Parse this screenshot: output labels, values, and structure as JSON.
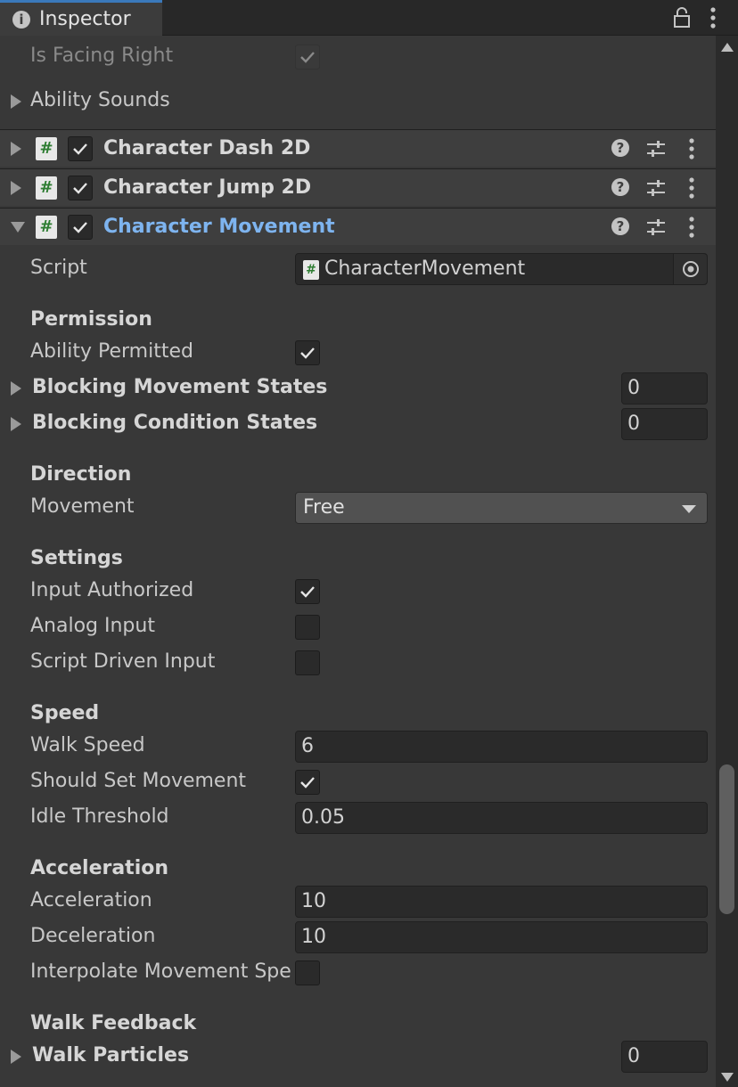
{
  "window": {
    "tab_title": "Inspector",
    "tab_icon": "info-icon",
    "lock_icon": "lock-icon",
    "menu_icon": "kebab-menu-icon"
  },
  "previous_component": {
    "is_facing_right_label": "Is Facing Right",
    "is_facing_right_checked": true,
    "ability_sounds_label": "Ability Sounds"
  },
  "components": [
    {
      "name": "Character Dash 2D",
      "expanded": false,
      "enabled": true
    },
    {
      "name": "Character Jump 2D",
      "expanded": false,
      "enabled": true
    },
    {
      "name": "Character Movement",
      "expanded": true,
      "enabled": true
    }
  ],
  "movement": {
    "script_label": "Script",
    "script_value": "CharacterMovement",
    "permission": {
      "header": "Permission",
      "ability_permitted_label": "Ability Permitted",
      "ability_permitted": true,
      "blocking_movement_states_label": "Blocking Movement States",
      "blocking_movement_states_count": "0",
      "blocking_condition_states_label": "Blocking Condition States",
      "blocking_condition_states_count": "0"
    },
    "direction": {
      "header": "Direction",
      "movement_label": "Movement",
      "movement_value": "Free"
    },
    "settings": {
      "header": "Settings",
      "input_authorized_label": "Input Authorized",
      "input_authorized": true,
      "analog_input_label": "Analog Input",
      "analog_input": false,
      "script_driven_input_label": "Script Driven Input",
      "script_driven_input": false
    },
    "speed": {
      "header": "Speed",
      "walk_speed_label": "Walk Speed",
      "walk_speed": "6",
      "should_set_movement_label": "Should Set Movement",
      "should_set_movement": true,
      "idle_threshold_label": "Idle Threshold",
      "idle_threshold": "0.05"
    },
    "acceleration": {
      "header": "Acceleration",
      "acceleration_label": "Acceleration",
      "acceleration": "10",
      "deceleration_label": "Deceleration",
      "deceleration": "10",
      "interpolate_label": "Interpolate Movement Spe",
      "interpolate": false
    },
    "walk_feedback": {
      "header": "Walk Feedback",
      "walk_particles_label": "Walk Particles",
      "walk_particles_count": "0"
    }
  },
  "scrollbar": {
    "position_fraction": 0.72
  }
}
